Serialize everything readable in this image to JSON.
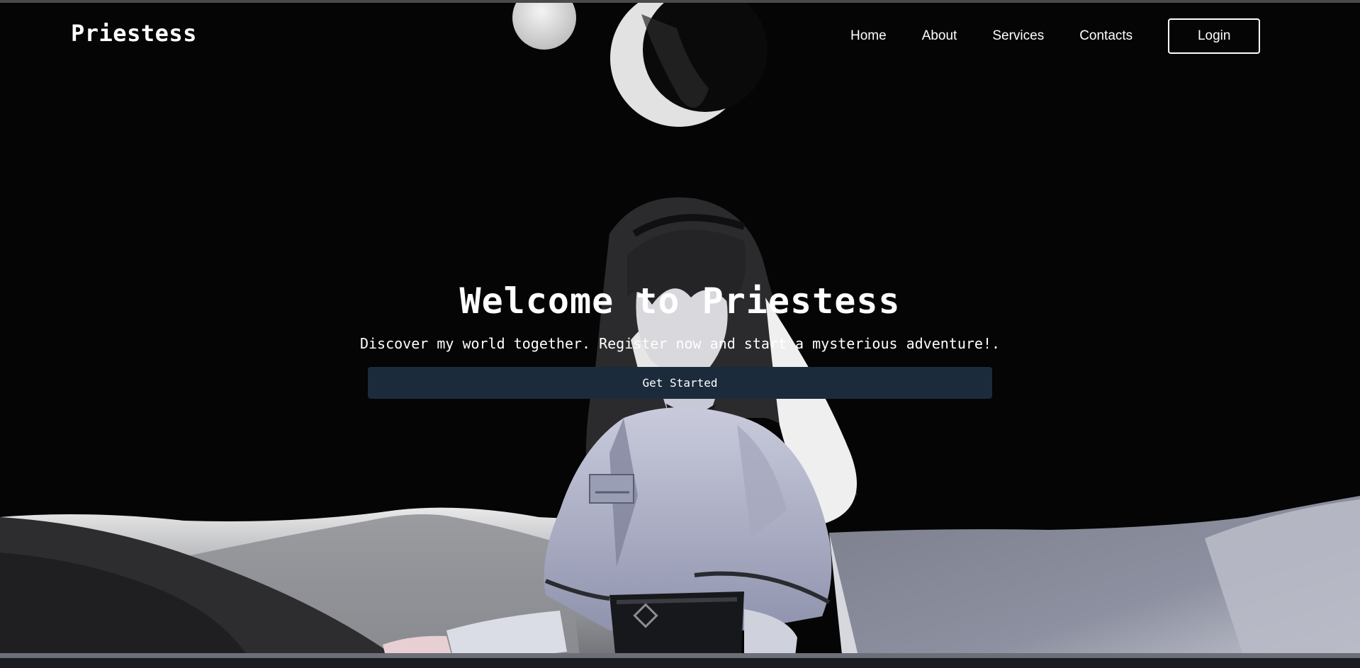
{
  "header": {
    "brand": "Priestess",
    "nav": [
      {
        "label": "Home"
      },
      {
        "label": "About"
      },
      {
        "label": "Services"
      },
      {
        "label": "Contacts"
      }
    ],
    "login_label": "Login"
  },
  "hero": {
    "title": "Welcome to Priestess",
    "subtitle": "Discover my world together. Register now and start a mysterious adventure!.",
    "cta_label": "Get Started"
  },
  "colors": {
    "background": "#050505",
    "cta": "#1b2b3b",
    "text": "#ffffff",
    "mountains": "#9a9ca6"
  }
}
